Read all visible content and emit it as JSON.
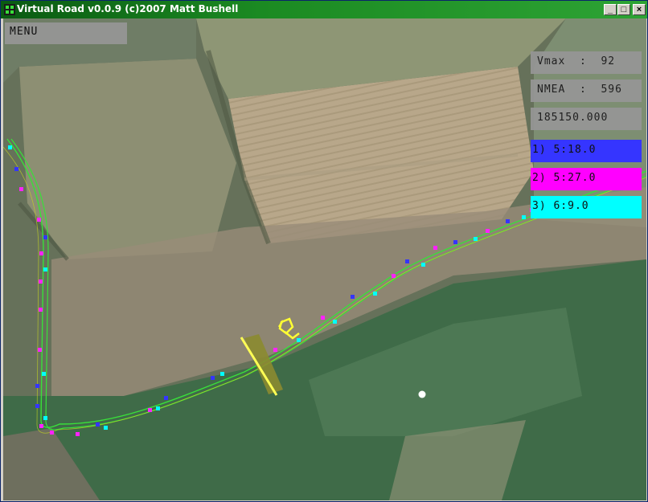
{
  "window": {
    "title": "Virtual Road v0.0.9 (c)2007 Matt Bushell",
    "controls": {
      "minimize": "_",
      "maximize": "□",
      "close": "×"
    }
  },
  "hud": {
    "menu_label": "MENU",
    "vmax": "Vmax  :  92",
    "nmea": "NMEA  :  596",
    "time": "185150.000",
    "laps": [
      {
        "label": "1) 5:18.0",
        "color": "#3535ff"
      },
      {
        "label": "2) 5:27.0",
        "color": "#ff00ff"
      },
      {
        "label": "3) 6:9.0",
        "color": "#00ffff"
      }
    ]
  },
  "colors": {
    "titlebar_start": "#0a5a12",
    "track_line": "#39e03a",
    "car_marker": "#ffff33",
    "dot": "#ffffff"
  },
  "icons": [
    "app-icon",
    "car-icon",
    "position-dot"
  ]
}
